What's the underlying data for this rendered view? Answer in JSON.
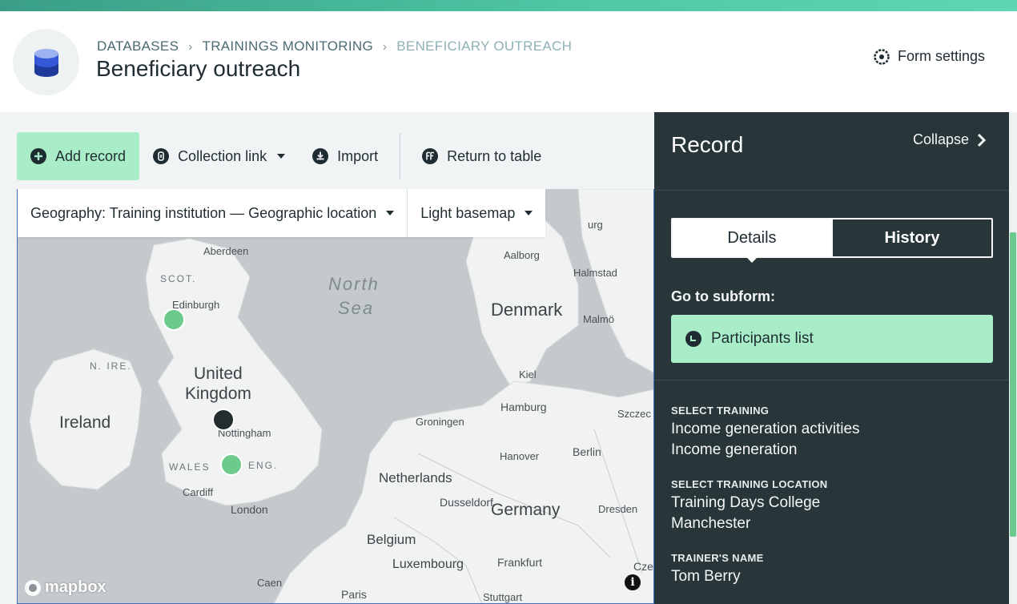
{
  "header": {
    "breadcrumb": [
      "DATABASES",
      "TRAININGS MONITORING",
      "BENEFICIARY OUTREACH"
    ],
    "title": "Beneficiary outreach",
    "form_settings": "Form settings"
  },
  "toolbar": {
    "add_record": "Add record",
    "collection_link": "Collection link",
    "import": "Import",
    "return_to_table": "Return to table"
  },
  "map": {
    "geography_select": "Geography: Training institution — Geographic location",
    "basemap_select": "Light basemap",
    "attribution": "mapbox",
    "labels": {
      "north": "North",
      "sea": "Sea",
      "denmark": "Denmark",
      "united": "United",
      "kingdom": "Kingdom",
      "ireland": "Ireland",
      "netherlands": "Netherlands",
      "germany": "Germany",
      "belgium": "Belgium",
      "luxembourg": "Luxembourg",
      "scot": "SCOT.",
      "nire": "N. IRE.",
      "wales": "WALES",
      "eng": "ENG.",
      "aberdeen": "Aberdeen",
      "edinburgh": "Edinburgh",
      "aalborg": "Aalborg",
      "halmstad": "Halmstad",
      "malmo": "Malmö",
      "kiel": "Kiel",
      "hamburg": "Hamburg",
      "groningen": "Groningen",
      "hanover": "Hanover",
      "berlin": "Berlin",
      "szczec": "Szczec",
      "nottingham": "Nottingham",
      "cardiff": "Cardiff",
      "london": "London",
      "dusseldorf": "Dusseldorf",
      "dresden": "Dresden",
      "frankfurt": "Frankfurt",
      "caen": "Caen",
      "paris": "Paris",
      "stuttgart": "Stuttgart",
      "cze": "Cze",
      "urg": "urg"
    }
  },
  "panel": {
    "title": "Record",
    "collapse": "Collapse",
    "tabs": [
      "Details",
      "History"
    ],
    "subform_label": "Go to subform:",
    "subform_button": "Participants list",
    "fields": [
      {
        "label": "SELECT TRAINING",
        "values": [
          "Income generation activities",
          "Income generation"
        ]
      },
      {
        "label": "SELECT TRAINING LOCATION",
        "values": [
          "Training Days College",
          "Manchester"
        ]
      },
      {
        "label": "TRAINER'S NAME",
        "values": [
          "Tom Berry"
        ]
      }
    ]
  },
  "colors": {
    "accent_green": "#a8edc8",
    "marker_green": "#6ccb8c",
    "panel_bg": "#28363a",
    "brand_teal": "#4fc9a6"
  }
}
